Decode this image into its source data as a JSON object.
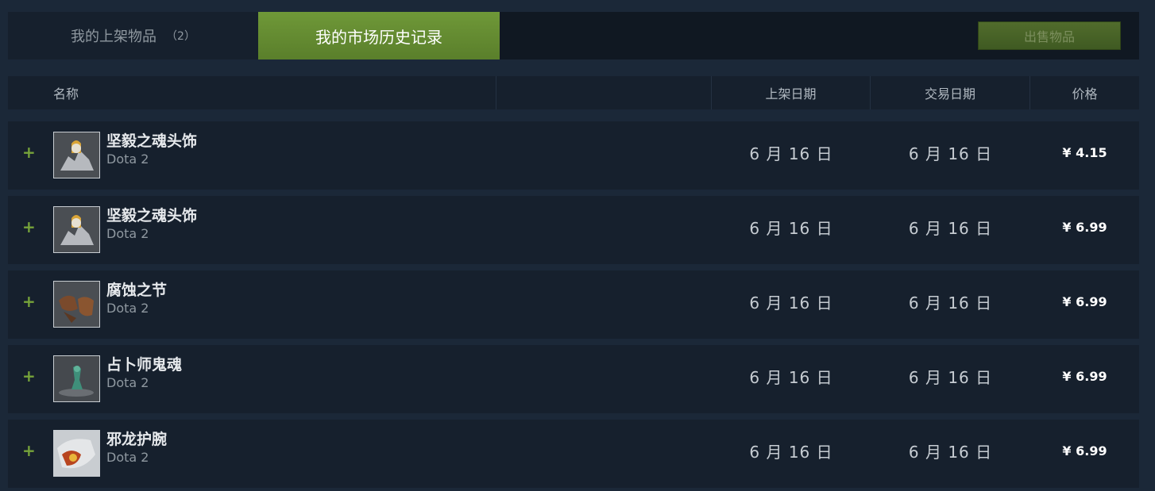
{
  "tabs": {
    "my_listings_label": "我的上架物品",
    "my_listings_count": "（2）",
    "history_label": "我的市场历史记录"
  },
  "sell_button_label": "出售物品",
  "columns": {
    "name": "名称",
    "listed_on": "上架日期",
    "acted_on": "交易日期",
    "price": "价格"
  },
  "rows": [
    {
      "expand": "+",
      "name": "坚毅之魂头饰",
      "game": "Dota 2",
      "listed": "6 月 16 日",
      "acted": "6 月 16 日",
      "price": "¥ 4.15",
      "icon": "ghost-headdress-icon"
    },
    {
      "expand": "+",
      "name": "坚毅之魂头饰",
      "game": "Dota 2",
      "listed": "6 月 16 日",
      "acted": "6 月 16 日",
      "price": "¥ 6.99",
      "icon": "ghost-headdress-icon"
    },
    {
      "expand": "+",
      "name": "腐蚀之节",
      "game": "Dota 2",
      "listed": "6 月 16 日",
      "acted": "6 月 16 日",
      "price": "¥ 6.99",
      "icon": "bracers-icon"
    },
    {
      "expand": "+",
      "name": "占卜师鬼魂",
      "game": "Dota 2",
      "listed": "6 月 16 日",
      "acted": "6 月 16 日",
      "price": "¥ 6.99",
      "icon": "seer-spirit-icon"
    },
    {
      "expand": "+",
      "name": "邪龙护腕",
      "game": "Dota 2",
      "listed": "6 月 16 日",
      "acted": "6 月 16 日",
      "price": "¥ 6.99",
      "icon": "dragon-bracer-icon"
    }
  ],
  "colors": {
    "background": "#1b2838",
    "row": "#16202d",
    "active_tab": "#6f9838",
    "accent_plus": "#76a33a"
  }
}
